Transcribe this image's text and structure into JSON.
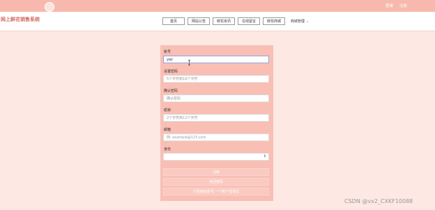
{
  "topbar": {
    "login_label": "登录",
    "register_label": "注册"
  },
  "header": {
    "site_title": "网上鲜花销售系统",
    "nav": [
      {
        "label": "首页"
      },
      {
        "label": "网站公告"
      },
      {
        "label": "鲜花资讯"
      },
      {
        "label": "在线留言"
      },
      {
        "label": "鲜花商城"
      },
      {
        "label": "商城管理",
        "has_dropdown": true
      }
    ]
  },
  "form": {
    "account": {
      "label": "账号",
      "value": "yeji"
    },
    "password": {
      "label": "设置密码",
      "placeholder": "5个字符到16个字符"
    },
    "confirm_password": {
      "label": "确认密码",
      "placeholder": "确认密码"
    },
    "nickname": {
      "label": "昵称",
      "placeholder": "2个字符到12个字符"
    },
    "email": {
      "label": "邮箱",
      "placeholder": "例: example@123.com"
    },
    "role": {
      "label": "身份",
      "selected": ""
    },
    "register_button": "注册",
    "forgot_button": "找回密码",
    "login_link": "已经拥有账号,一个账户登录去"
  },
  "watermark": "CSDN @vx2_CXKF10088"
}
